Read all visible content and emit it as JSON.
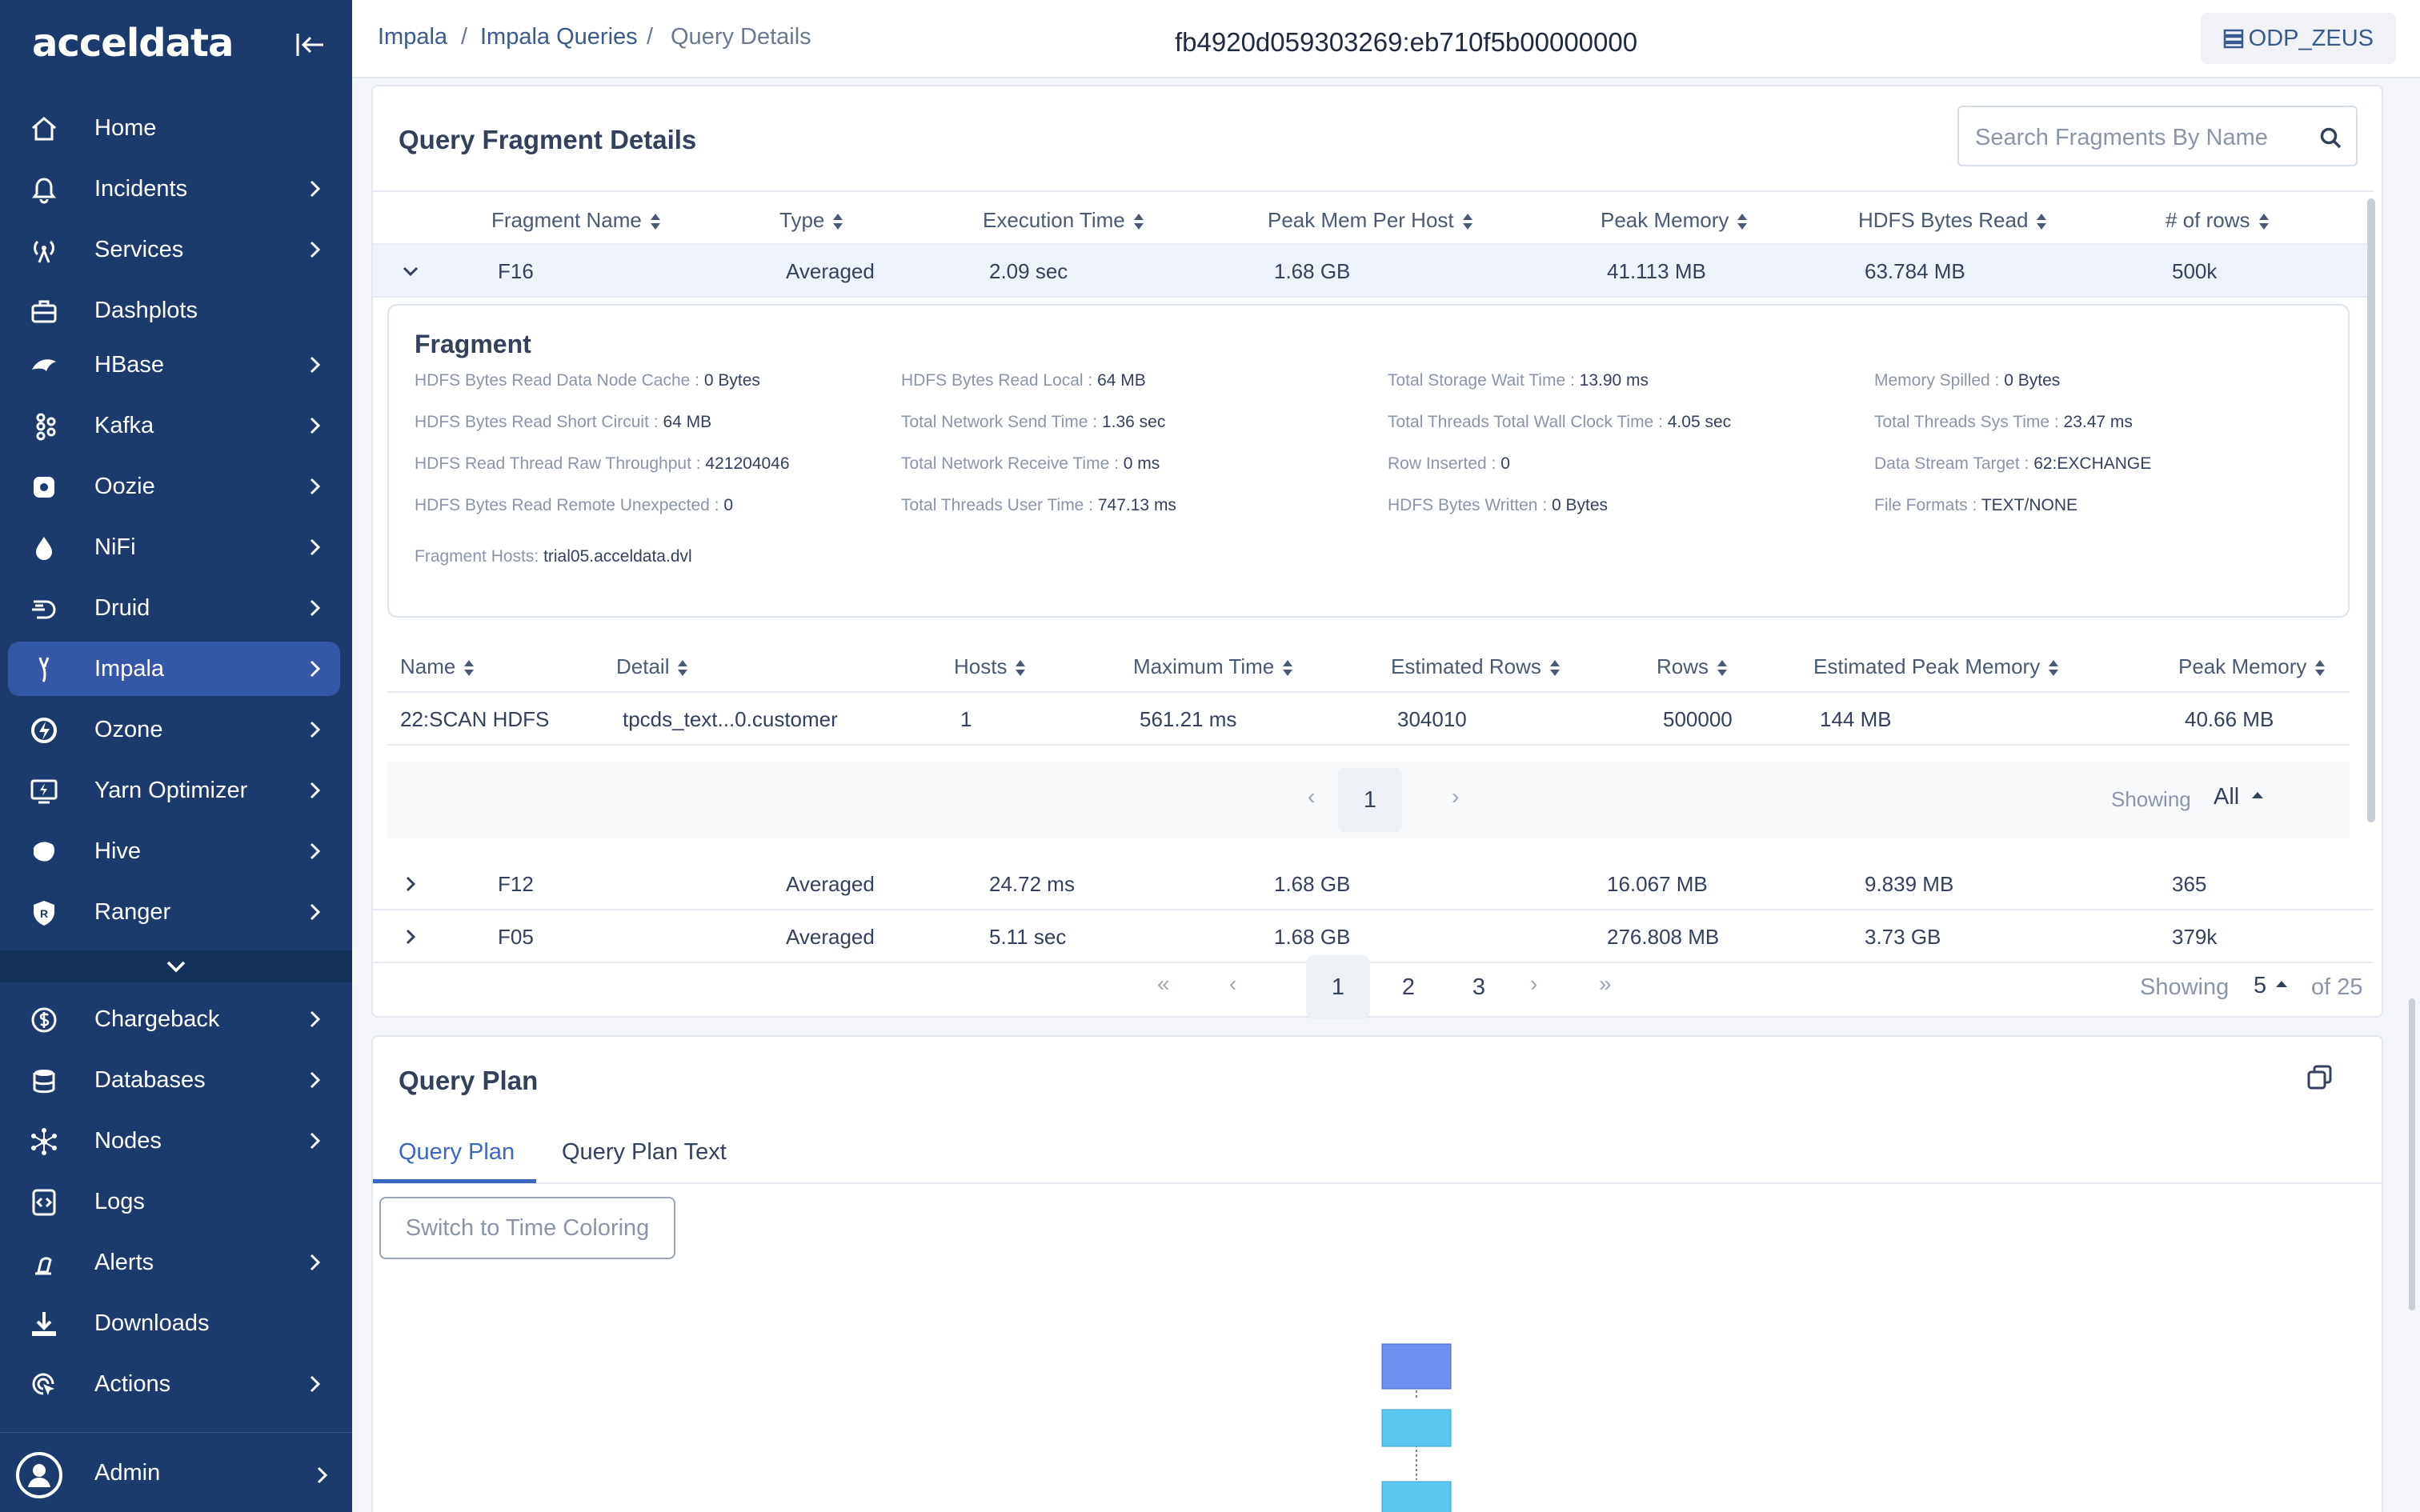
{
  "sidebar": {
    "logo": "acceldata",
    "items": [
      {
        "label": "Home",
        "icon": "home-icon",
        "has_children": false
      },
      {
        "label": "Incidents",
        "icon": "bell-icon",
        "has_children": true
      },
      {
        "label": "Services",
        "icon": "antenna-icon",
        "has_children": true
      },
      {
        "label": "Dashplots",
        "icon": "briefcase-icon",
        "has_children": false
      },
      {
        "label": "HBase",
        "icon": "hbase-icon",
        "has_children": true
      },
      {
        "label": "Kafka",
        "icon": "kafka-icon",
        "has_children": true
      },
      {
        "label": "Oozie",
        "icon": "oozie-icon",
        "has_children": true
      },
      {
        "label": "NiFi",
        "icon": "drop-icon",
        "has_children": true
      },
      {
        "label": "Druid",
        "icon": "druid-icon",
        "has_children": true
      },
      {
        "label": "Impala",
        "icon": "impala-icon",
        "has_children": true,
        "active": true
      },
      {
        "label": "Ozone",
        "icon": "ozone-icon",
        "has_children": true
      },
      {
        "label": "Yarn Optimizer",
        "icon": "monitor-bolt-icon",
        "has_children": true
      },
      {
        "label": "Hive",
        "icon": "hive-icon",
        "has_children": true
      },
      {
        "label": "Ranger",
        "icon": "shield-icon",
        "has_children": true
      },
      {
        "label": "Chargeback",
        "icon": "dollar-icon",
        "has_children": true
      },
      {
        "label": "Databases",
        "icon": "database-icon",
        "has_children": true
      },
      {
        "label": "Nodes",
        "icon": "nodes-icon",
        "has_children": true
      },
      {
        "label": "Logs",
        "icon": "code-file-icon",
        "has_children": false
      },
      {
        "label": "Alerts",
        "icon": "alert-bell-icon",
        "has_children": true
      },
      {
        "label": "Downloads",
        "icon": "download-icon",
        "has_children": false
      },
      {
        "label": "Actions",
        "icon": "cursor-target-icon",
        "has_children": true
      }
    ],
    "admin_label": "Admin"
  },
  "header": {
    "breadcrumbs": [
      "Impala",
      "Impala Queries",
      "Query Details"
    ],
    "query_id": "fb4920d059303269:eb710f5b00000000",
    "cluster": "ODP_ZEUS"
  },
  "fragments": {
    "title": "Query Fragment Details",
    "search_placeholder": "Search Fragments By Name",
    "columns": [
      "Fragment Name",
      "Type",
      "Execution Time",
      "Peak Mem Per Host",
      "Peak Memory",
      "HDFS Bytes Read",
      "# of rows"
    ],
    "rows": [
      {
        "name": "F16",
        "type": "Averaged",
        "exec": "2.09 sec",
        "peak_mem_host": "1.68 GB",
        "peak_mem": "41.113 MB",
        "hdfs_read": "63.784 MB",
        "rows": "500k",
        "expanded": true
      },
      {
        "name": "F12",
        "type": "Averaged",
        "exec": "24.72 ms",
        "peak_mem_host": "1.68 GB",
        "peak_mem": "16.067 MB",
        "hdfs_read": "9.839 MB",
        "rows": "365"
      },
      {
        "name": "F05",
        "type": "Averaged",
        "exec": "5.11 sec",
        "peak_mem_host": "1.68 GB",
        "peak_mem": "276.808 MB",
        "hdfs_read": "3.73 GB",
        "rows": "379k"
      }
    ],
    "detail": {
      "title": "Fragment",
      "items": [
        {
          "k": "HDFS Bytes Read Data Node Cache : ",
          "v": "0 Bytes"
        },
        {
          "k": "HDFS Bytes Read Local : ",
          "v": "64 MB"
        },
        {
          "k": "Total Storage Wait Time : ",
          "v": "13.90 ms"
        },
        {
          "k": "Memory Spilled : ",
          "v": "0 Bytes"
        },
        {
          "k": "HDFS Bytes Read Short Circuit : ",
          "v": "64 MB"
        },
        {
          "k": "Total Network Send Time : ",
          "v": "1.36 sec"
        },
        {
          "k": "Total Threads Total Wall Clock Time : ",
          "v": "4.05 sec"
        },
        {
          "k": "Total Threads Sys Time : ",
          "v": "23.47 ms"
        },
        {
          "k": "HDFS Read Thread Raw Throughput : ",
          "v": "421204046"
        },
        {
          "k": "Total Network Receive Time : ",
          "v": "0 ms"
        },
        {
          "k": "Row Inserted : ",
          "v": "0"
        },
        {
          "k": "Data Stream Target : ",
          "v": "62:EXCHANGE"
        },
        {
          "k": "HDFS Bytes Read Remote Unexpected : ",
          "v": "0"
        },
        {
          "k": "Total Threads User Time : ",
          "v": "747.13 ms"
        },
        {
          "k": "HDFS Bytes Written : ",
          "v": "0 Bytes"
        },
        {
          "k": "File Formats : ",
          "v": "TEXT/NONE"
        }
      ],
      "hosts_label": "Fragment Hosts: ",
      "hosts_value": "trial05.acceldata.dvl"
    },
    "sub_table": {
      "columns": [
        "Name",
        "Detail",
        "Hosts",
        "Maximum Time",
        "Estimated Rows",
        "Rows",
        "Estimated Peak Memory",
        "Peak Memory"
      ],
      "row": [
        "22:SCAN HDFS",
        "tpcds_text...0.customer",
        "1",
        "561.21 ms",
        "304010",
        "500000",
        "144 MB",
        "40.66 MB"
      ],
      "page": "1",
      "showing_label": "Showing",
      "showing_value": "All"
    },
    "pager": {
      "pages": [
        "1",
        "2",
        "3"
      ],
      "current": "1",
      "showing_label": "Showing",
      "page_size": "5",
      "total": "of 25"
    }
  },
  "plan": {
    "title": "Query Plan",
    "tabs": [
      "Query Plan",
      "Query Plan Text"
    ],
    "active_tab": "Query Plan",
    "switch_label": "Switch to Time Coloring"
  },
  "colors": {
    "sidebar": "#1d3a6e",
    "active": "#3457a8",
    "accent": "#3b66c4",
    "plan_node_top": "#6f8ef0",
    "plan_node": "#59c7f0"
  }
}
